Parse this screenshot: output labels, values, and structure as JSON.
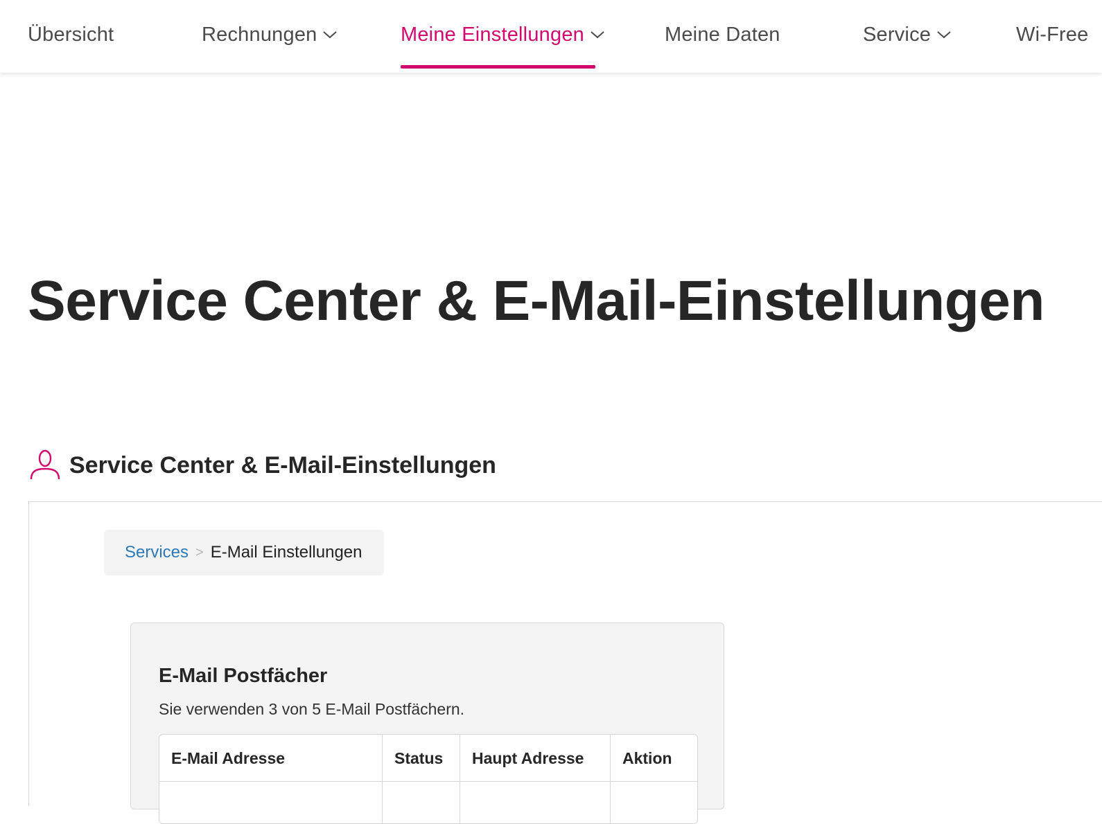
{
  "nav": {
    "items": [
      {
        "label": "Übersicht",
        "has_dropdown": false
      },
      {
        "label": "Rechnungen",
        "has_dropdown": true
      },
      {
        "label": "Meine Einstellungen",
        "has_dropdown": true,
        "active": true
      },
      {
        "label": "Meine Daten",
        "has_dropdown": false
      },
      {
        "label": "Service",
        "has_dropdown": true
      },
      {
        "label": "Wi-Free",
        "has_dropdown": false
      }
    ]
  },
  "page": {
    "title": "Service Center & E-Mail-Einstellungen"
  },
  "section": {
    "icon": "user-icon",
    "title": "Service Center & E-Mail-Einstellungen"
  },
  "breadcrumb": {
    "link": "Services",
    "separator": ">",
    "current": "E-Mail Einstellungen"
  },
  "mailboxes": {
    "heading": "E-Mail Postfächer",
    "usage_text": "Sie verwenden 3 von 5 E-Mail Postfächern.",
    "columns": [
      "E-Mail Adresse",
      "Status",
      "Haupt Adresse",
      "Aktion"
    ]
  },
  "colors": {
    "accent": "#d2096f",
    "link": "#2a7ab9",
    "text": "#262626"
  }
}
